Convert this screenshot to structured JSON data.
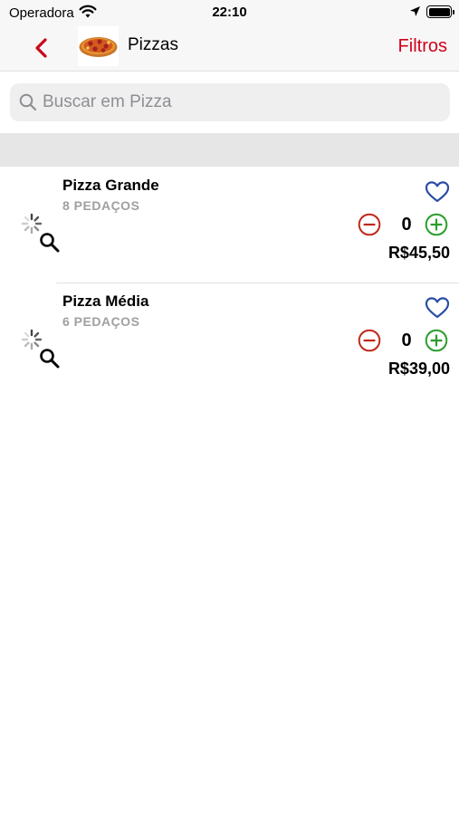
{
  "status_bar": {
    "carrier": "Operadora",
    "time": "22:10",
    "icons": [
      "wifi-icon",
      "location-arrow-icon",
      "battery-icon"
    ]
  },
  "nav": {
    "back_icon": "chevron-left-icon",
    "thumbnail_icon": "pizza-image",
    "title": "Pizzas",
    "filter_label": "Filtros"
  },
  "search": {
    "placeholder": "Buscar em Pizza",
    "value": "",
    "icon": "search-icon"
  },
  "products": [
    {
      "name": "Pizza Grande",
      "subtitle": "8 PEDAÇOS",
      "quantity": "0",
      "price": "R$45,50"
    },
    {
      "name": "Pizza Média",
      "subtitle": "6 PEDAÇOS",
      "quantity": "0",
      "price": "R$39,00"
    }
  ],
  "colors": {
    "accent": "#d0021b",
    "minus": "#c0281a",
    "plus": "#2a9d2a",
    "favorite": "#2c4fa3",
    "subtitle": "#a0a0a0"
  }
}
